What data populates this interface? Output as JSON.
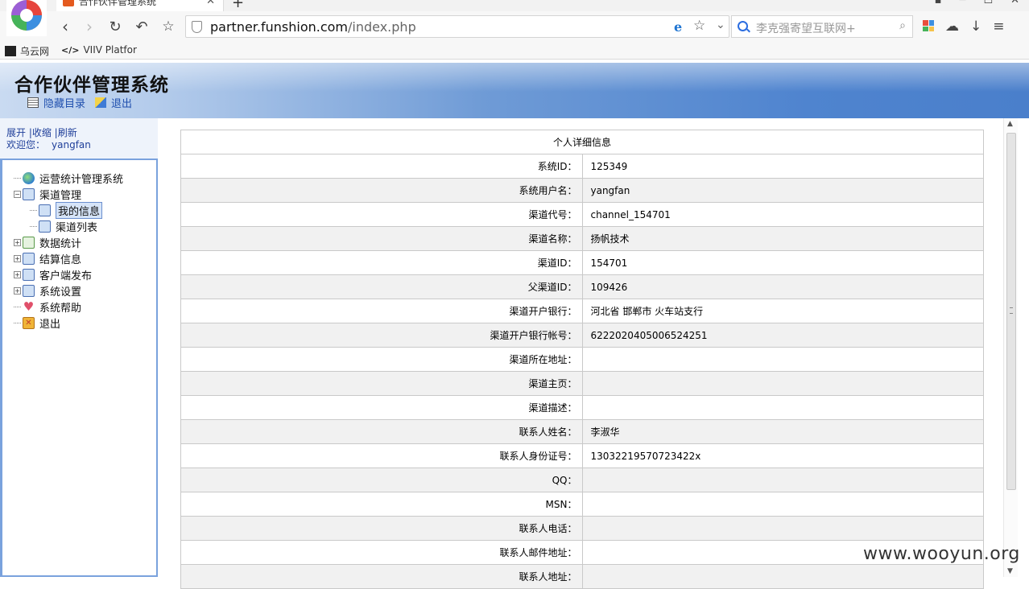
{
  "browser": {
    "tab_title": "合作伙伴管理系统",
    "url_host": "partner.funshion.com",
    "url_path": "/index.php",
    "search_placeholder": "李克强寄望互联网+",
    "bookmarks": [
      "乌云网",
      "VIIV Platfor"
    ]
  },
  "header": {
    "title": "合作伙伴管理系统",
    "links": [
      "隐藏目录",
      "退出"
    ]
  },
  "sidebar": {
    "controls": "展开 |收缩 |刷新",
    "welcome_label": "欢迎您：",
    "username": "yangfan",
    "tree": [
      {
        "label": "运营统计管理系统",
        "icon": "globe-icon"
      },
      {
        "label": "渠道管理",
        "icon": "folder-icon",
        "expanded": true
      },
      {
        "label": "我的信息",
        "icon": "folder-icon",
        "selected": true
      },
      {
        "label": "渠道列表",
        "icon": "folder-icon"
      },
      {
        "label": "数据统计",
        "icon": "page-icon"
      },
      {
        "label": "结算信息",
        "icon": "folder-icon"
      },
      {
        "label": "客户端发布",
        "icon": "folder-icon"
      },
      {
        "label": "系统设置",
        "icon": "folder-icon"
      },
      {
        "label": "系统帮助",
        "icon": "heart-icon"
      },
      {
        "label": "退出",
        "icon": "exit-icon"
      }
    ]
  },
  "detail": {
    "title": "个人详细信息",
    "rows": [
      {
        "label": "系统ID：",
        "value": "125349"
      },
      {
        "label": "系统用户名：",
        "value": "yangfan"
      },
      {
        "label": "渠道代号：",
        "value": "channel_154701"
      },
      {
        "label": "渠道名称：",
        "value": "扬帆技术"
      },
      {
        "label": "渠道ID：",
        "value": "154701"
      },
      {
        "label": "父渠道ID：",
        "value": "109426"
      },
      {
        "label": "渠道开户银行：",
        "value": "河北省 邯郸市 火车站支行"
      },
      {
        "label": "渠道开户银行帐号：",
        "value": "6222020405006524251"
      },
      {
        "label": "渠道所在地址：",
        "value": ""
      },
      {
        "label": "渠道主页：",
        "value": ""
      },
      {
        "label": "渠道描述：",
        "value": ""
      },
      {
        "label": "联系人姓名：",
        "value": "李淑华"
      },
      {
        "label": "联系人身份证号：",
        "value": "13032219570723422x"
      },
      {
        "label": "QQ：",
        "value": ""
      },
      {
        "label": "MSN：",
        "value": ""
      },
      {
        "label": "联系人电话：",
        "value": ""
      },
      {
        "label": "联系人邮件地址：",
        "value": ""
      },
      {
        "label": "联系人地址：",
        "value": ""
      }
    ]
  },
  "watermark": "www.wooyun.org"
}
